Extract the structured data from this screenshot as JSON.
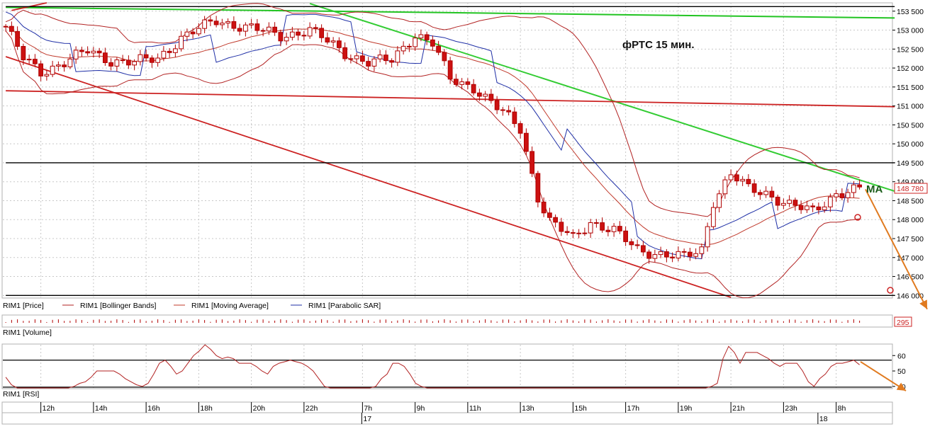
{
  "chart_data": {
    "type": "candlestick",
    "title": "фРТС  15 мин.",
    "annotations": {
      "ma_label": "MA",
      "last_price_label": "148 780",
      "volume_last_label": "295"
    },
    "price_axis": {
      "ylim": [
        145950,
        153720
      ],
      "ticks": [
        "153 500",
        "153 000",
        "152 500",
        "152 000",
        "151 500",
        "151 000",
        "150 500",
        "150 000",
        "149 500",
        "149 000",
        "148 500",
        "148 000",
        "147 500",
        "147 000",
        "146 500",
        "146 000"
      ],
      "tick_values": [
        153500,
        153000,
        152500,
        152000,
        151500,
        151000,
        150500,
        150000,
        149500,
        149000,
        148500,
        148000,
        147500,
        147000,
        146500,
        146000
      ]
    },
    "time_axis": {
      "hour_labels": [
        "12h",
        "14h",
        "16h",
        "18h",
        "20h",
        "22h",
        "7h",
        "9h",
        "11h",
        "13h",
        "15h",
        "17h",
        "19h",
        "21h",
        "23h",
        "8h"
      ],
      "hour_label_bar_index": [
        6,
        15,
        24,
        33,
        42,
        51,
        61,
        70,
        79,
        88,
        97,
        106,
        115,
        124,
        133,
        142
      ],
      "day_labels": [
        "17",
        "18"
      ],
      "day_label_bar_index": [
        61,
        139
      ],
      "bars_visible": 152
    },
    "legend": [
      {
        "text": "RIM1 [Price]",
        "color": "#000000",
        "swatch": false
      },
      {
        "text": "RIM1 [Bollinger Bands]",
        "color": "#b22222",
        "swatch": true
      },
      {
        "text": "RIM1 [Moving Average]",
        "color": "#c0392b",
        "swatch": true
      },
      {
        "text": "RIM1 [Parabolic SAR]",
        "color": "#1f2fa6",
        "swatch": true
      }
    ],
    "volume_panel": {
      "label": "RIM1 [Volume]"
    },
    "rsi_panel": {
      "label": "RIM1 [RSI]",
      "ylim": [
        39,
        67
      ],
      "ticks": [
        "60",
        "50",
        "40"
      ],
      "tick_values": [
        60,
        50,
        40
      ],
      "levels": [
        57,
        39.5
      ],
      "values": [
        46,
        41,
        38,
        38,
        38,
        38,
        38,
        38,
        38,
        38,
        38,
        38,
        40,
        42,
        43,
        46,
        50,
        50,
        50,
        50,
        48,
        45,
        43,
        41,
        40,
        42,
        48,
        55,
        57,
        53,
        48,
        50,
        55,
        60,
        63,
        68,
        64,
        60,
        58,
        59,
        58,
        55,
        55,
        55,
        53,
        50,
        48,
        53,
        55,
        56,
        57,
        56,
        55,
        53,
        50,
        45,
        40,
        38,
        38,
        38,
        38,
        38,
        38,
        38,
        38,
        40,
        45,
        48,
        55,
        55,
        53,
        48,
        42,
        40,
        38,
        38,
        38,
        38,
        38,
        38,
        38,
        38,
        38,
        38,
        38,
        38,
        38,
        38,
        38,
        38,
        38,
        38,
        38,
        38,
        38,
        38,
        38,
        38,
        38,
        38,
        38,
        38,
        38,
        38,
        38,
        38,
        38,
        38,
        38,
        38,
        38,
        38,
        38,
        38,
        38,
        38,
        38,
        38,
        38,
        38,
        38,
        38,
        38,
        38,
        40,
        42,
        58,
        66,
        62,
        55,
        62,
        62,
        62,
        60,
        58,
        55,
        53,
        55,
        55,
        55,
        50,
        43,
        40,
        45,
        48,
        53,
        55,
        55,
        56,
        57,
        54
      ]
    },
    "trendlines": [
      {
        "name": "green-upper",
        "color": "#22c422",
        "points": [
          [
            0,
            153600
          ],
          [
            152,
            153320
          ]
        ]
      },
      {
        "name": "green-resistance",
        "color": "#33cc33",
        "points": [
          [
            52,
            153700
          ],
          [
            152,
            148750
          ]
        ]
      },
      {
        "name": "red-horizontal",
        "color": "#cc2222",
        "points": [
          [
            0,
            151400
          ],
          [
            152,
            150980
          ]
        ]
      },
      {
        "name": "red-support",
        "color": "#cc2222",
        "points": [
          [
            0,
            152300
          ],
          [
            124,
            145950
          ]
        ]
      },
      {
        "name": "red-short",
        "color": "#cc2222",
        "points": [
          [
            1,
            153520
          ],
          [
            7,
            153720
          ]
        ]
      },
      {
        "name": "black-top",
        "color": "#000000",
        "points": [
          [
            0,
            153620
          ],
          [
            152,
            153620
          ]
        ]
      },
      {
        "name": "black-resistance",
        "color": "#000000",
        "points": [
          [
            0,
            149500
          ],
          [
            152,
            149500
          ]
        ]
      },
      {
        "name": "black-bottom",
        "color": "#000000",
        "points": [
          [
            0,
            146000
          ],
          [
            152,
            146000
          ]
        ]
      }
    ],
    "forecast_arrows": [
      {
        "panel": "price",
        "from": [
          148800,
          148650
        ],
        "to": [
          0,
          145900
        ]
      },
      {
        "panel": "rsi",
        "from": [
          56,
          56
        ],
        "to": [
          39,
          39
        ]
      }
    ],
    "close_path": [
      [
        0,
        153100
      ],
      [
        3,
        152250
      ],
      [
        6,
        151900
      ],
      [
        10,
        152150
      ],
      [
        14,
        152450
      ],
      [
        18,
        152200
      ],
      [
        22,
        152150
      ],
      [
        26,
        152250
      ],
      [
        30,
        152800
      ],
      [
        36,
        153250
      ],
      [
        42,
        153050
      ],
      [
        47,
        152850
      ],
      [
        52,
        153000
      ],
      [
        58,
        152400
      ],
      [
        62,
        152150
      ],
      [
        66,
        152200
      ],
      [
        70,
        152900
      ],
      [
        73,
        152650
      ],
      [
        76,
        151700
      ],
      [
        80,
        151500
      ],
      [
        84,
        150950
      ],
      [
        88,
        150400
      ],
      [
        91,
        148600
      ],
      [
        93,
        147950
      ],
      [
        97,
        147500
      ],
      [
        100,
        147950
      ],
      [
        104,
        147700
      ],
      [
        108,
        147200
      ],
      [
        112,
        147100
      ],
      [
        116,
        147000
      ],
      [
        119,
        147200
      ],
      [
        121,
        148500
      ],
      [
        124,
        149200
      ],
      [
        127,
        148800
      ],
      [
        130,
        148700
      ],
      [
        134,
        148400
      ],
      [
        138,
        148200
      ],
      [
        142,
        148700
      ],
      [
        146,
        148800
      ]
    ]
  }
}
